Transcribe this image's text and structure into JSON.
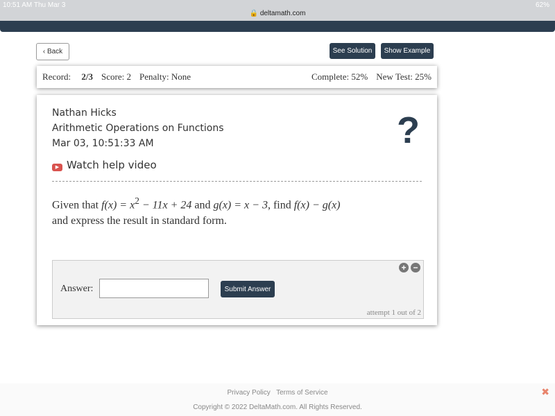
{
  "status": {
    "time": "10:51 AM  Thu Mar 3",
    "url": "deltamath.com",
    "battery": "62%"
  },
  "buttons": {
    "back": "Back",
    "see_solution": "See Solution",
    "show_example": "Show Example",
    "submit": "Submit Answer"
  },
  "record": {
    "record_label": "Record:",
    "record": "2/3",
    "score": "Score: 2",
    "penalty": "Penalty: None",
    "complete": "Complete: 52%",
    "new_test": "New Test: 25%"
  },
  "header": {
    "name": "Nathan Hicks",
    "topic": "Arithmetic Operations on Functions",
    "date": "Mar 03, 10:51:33 AM",
    "help": "Watch help video"
  },
  "question": {
    "p1": "Given that ",
    "f": "f(x) = x",
    "exp": "2",
    "f2": " − 11x + 24",
    "and": " and ",
    "g": "g(x) = x − 3",
    "find": ", find ",
    "fg": "f(x) − g(x)",
    "p2": "and express the result in standard form."
  },
  "answer": {
    "label": "Answer:",
    "value": "",
    "attempt": "attempt 1 out of 2"
  },
  "footer": {
    "privacy": "Privacy Policy",
    "terms": "Terms of Service",
    "copyright": "Copyright © 2022 DeltaMath.com. All Rights Reserved."
  }
}
